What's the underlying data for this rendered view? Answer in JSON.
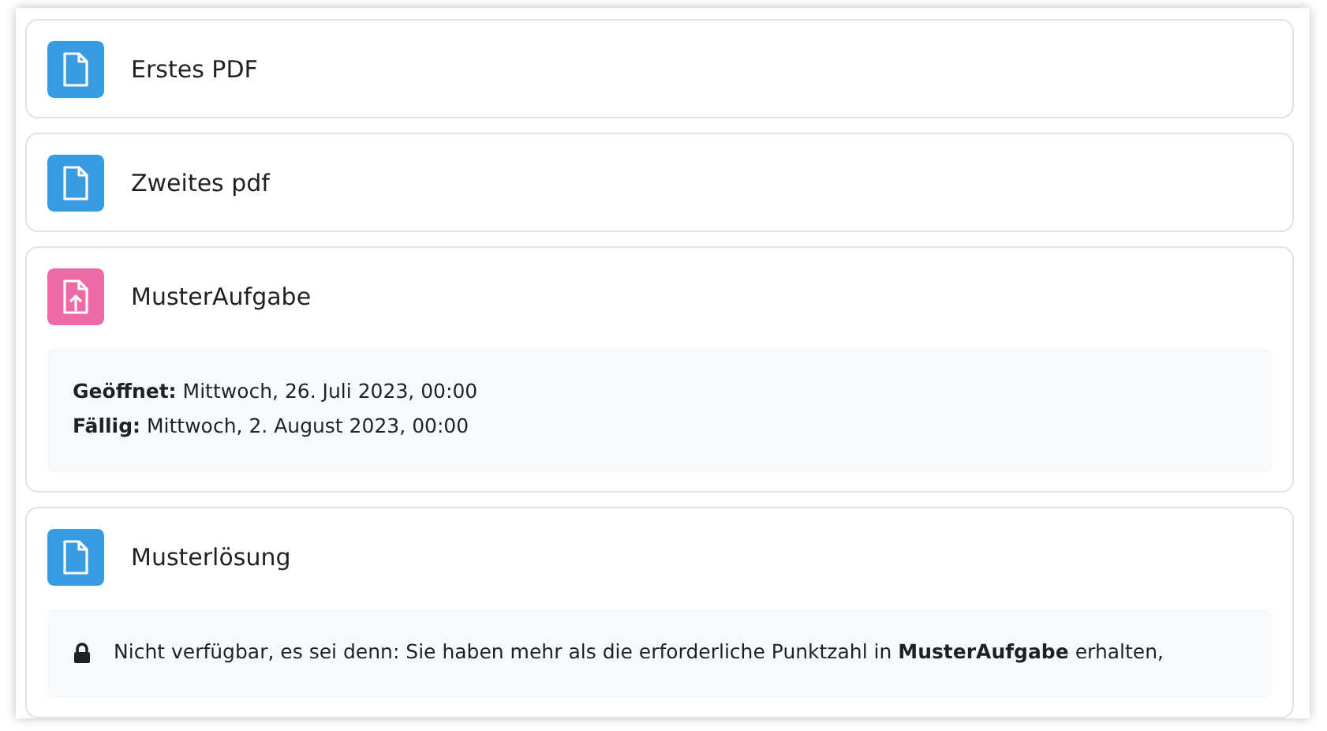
{
  "activities": [
    {
      "kind": "file",
      "title": "Erstes PDF"
    },
    {
      "kind": "file",
      "title": "Zweites pdf"
    },
    {
      "kind": "assignment",
      "title": "MusterAufgabe",
      "dates": [
        "**Geöffnet:** Mittwoch, 26. Juli 2023, 00:00",
        "**Fällig:** Mittwoch, 2. August 2023, 00:00"
      ]
    },
    {
      "kind": "file",
      "title": "Musterlösung",
      "restriction": "Nicht verfügbar, es sei denn: Sie haben mehr als die erforderliche Punktzahl in **MusterAufgabe** erhalten,"
    }
  ]
}
